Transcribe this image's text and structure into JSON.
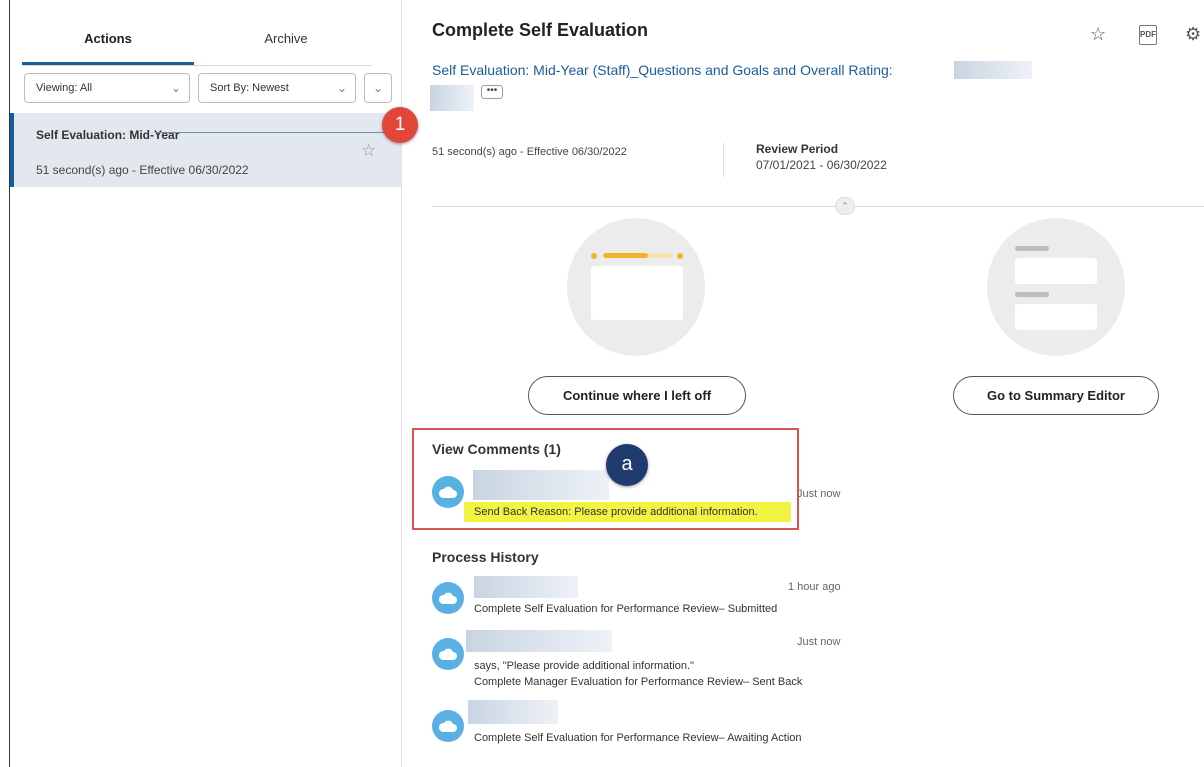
{
  "tabs": {
    "actions": "Actions",
    "archive": "Archive"
  },
  "filters": {
    "viewing": "Viewing: All",
    "sort": "Sort By: Newest"
  },
  "inbox_item": {
    "title": "Self Evaluation: Mid-Year",
    "subtitle": "51 second(s) ago - Effective 06/30/2022"
  },
  "callouts": {
    "one": "1",
    "a": "a"
  },
  "header": {
    "title": "Complete Self Evaluation",
    "link": "Self Evaluation: Mid-Year (Staff)_Questions and Goals and Overall Rating:",
    "more": "•••",
    "pdf": "PDF"
  },
  "meta": {
    "timestamp": "51 second(s) ago - Effective 06/30/2022",
    "review_period_label": "Review Period",
    "review_period_value": "07/01/2021 - 06/30/2022"
  },
  "actions": {
    "continue": "Continue where I left off",
    "summary": "Go to Summary Editor"
  },
  "comments": {
    "title": "View Comments (1)",
    "time": "Just now",
    "text": "Send Back Reason: Please provide additional information."
  },
  "history": {
    "title": "Process History",
    "entries": [
      {
        "time": "1 hour ago",
        "line1": "Complete Self Evaluation for Performance Review– Submitted"
      },
      {
        "time": "Just now",
        "line1": "says, \"Please provide additional information.\"",
        "line2": "Complete Manager Evaluation for Performance Review– Sent Back"
      },
      {
        "line1": "Complete Self Evaluation for Performance Review– Awaiting Action"
      }
    ]
  },
  "colors": {
    "accent": "#1a5d9c",
    "highlight": "#f1f542",
    "callout_red": "#e0463a",
    "callout_navy": "#1e3a6e",
    "avatar": "#59b0e3",
    "progress": "#f0b429"
  },
  "icons": [
    "star-icon",
    "pdf-icon",
    "gear-icon",
    "chevron-down-icon",
    "chevron-up-icon",
    "cloud-avatar-icon"
  ]
}
